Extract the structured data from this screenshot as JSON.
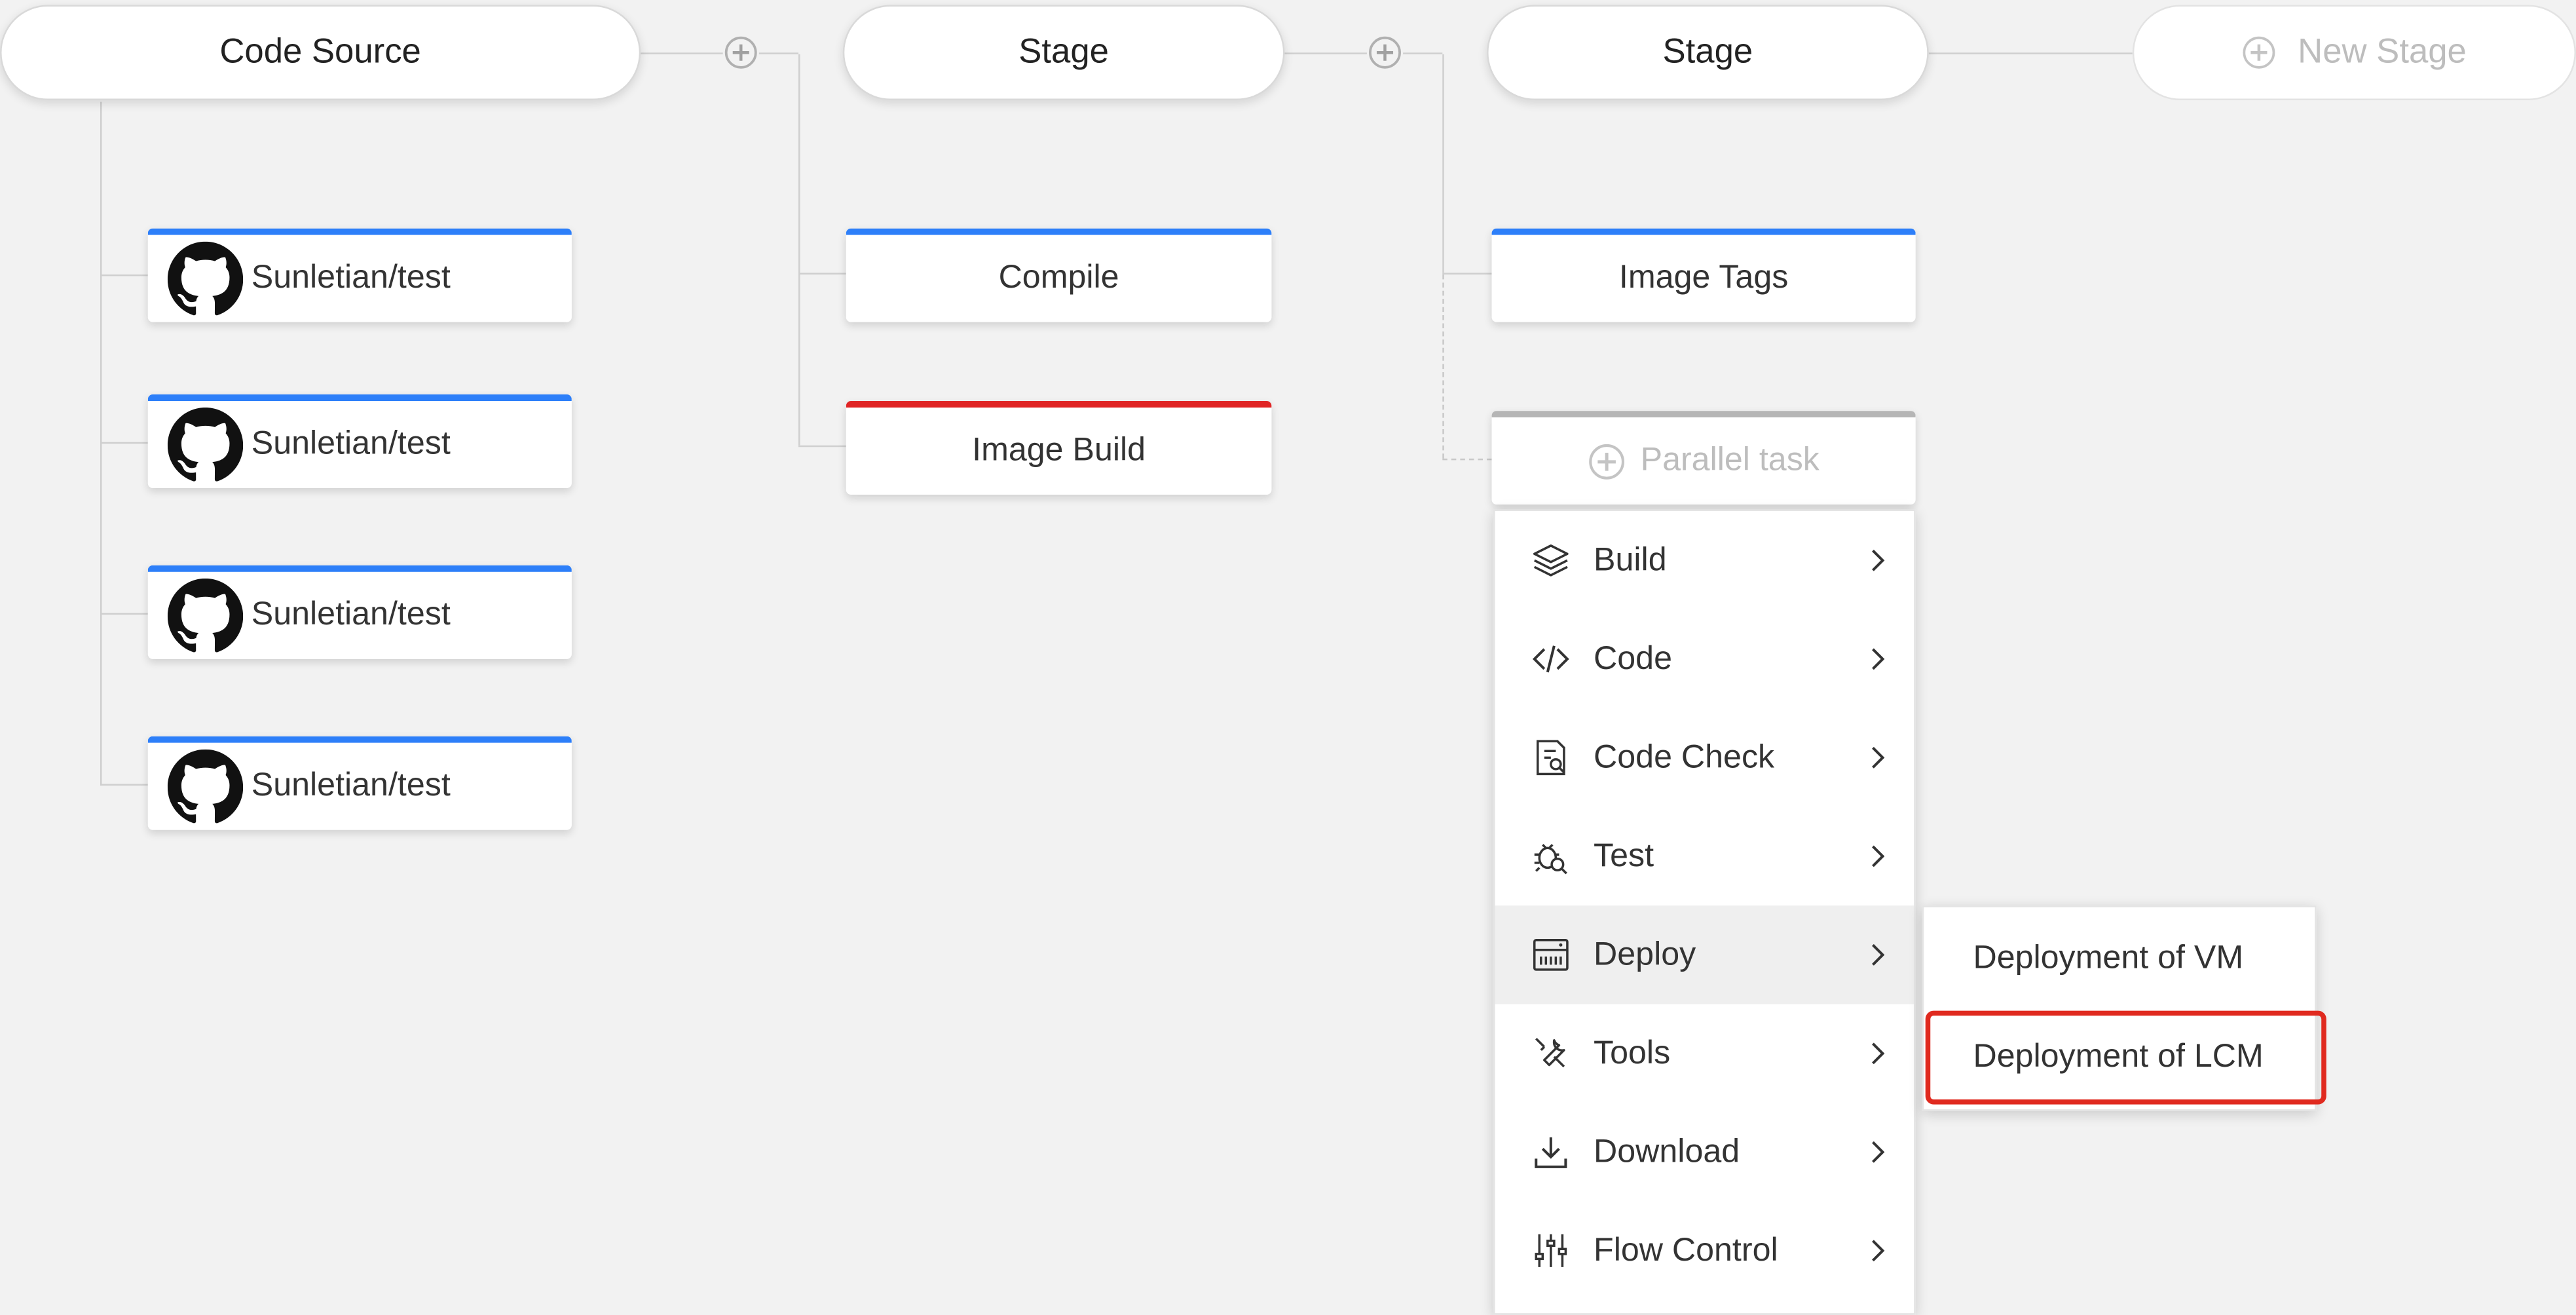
{
  "stages": [
    {
      "label": "Code Source"
    },
    {
      "label": "Stage"
    },
    {
      "label": "Stage"
    },
    {
      "label": "New Stage"
    }
  ],
  "sources": [
    {
      "label": "Sunletian/test"
    },
    {
      "label": "Sunletian/test"
    },
    {
      "label": "Sunletian/test"
    },
    {
      "label": "Sunletian/test"
    }
  ],
  "stage1_tasks": [
    {
      "label": "Compile",
      "status": "blue"
    },
    {
      "label": "Image Build",
      "status": "red"
    }
  ],
  "stage2_tasks": [
    {
      "label": "Image Tags"
    }
  ],
  "parallel_task": {
    "label": "Parallel task"
  },
  "menu": {
    "items": [
      {
        "label": "Build",
        "icon": "layers-icon"
      },
      {
        "label": "Code",
        "icon": "code-icon"
      },
      {
        "label": "Code Check",
        "icon": "code-check-icon"
      },
      {
        "label": "Test",
        "icon": "bug-search-icon"
      },
      {
        "label": "Deploy",
        "icon": "server-icon"
      },
      {
        "label": "Tools",
        "icon": "tools-icon"
      },
      {
        "label": "Download",
        "icon": "download-icon"
      },
      {
        "label": "Flow Control",
        "icon": "sliders-icon"
      }
    ],
    "active": "Deploy"
  },
  "submenu": {
    "items": [
      {
        "label": "Deployment of VM"
      },
      {
        "label": "Deployment of LCM"
      }
    ],
    "highlighted": "Deployment of LCM"
  },
  "colors": {
    "blue_accent": "#2d7ff9",
    "red_accent": "#e02424",
    "highlight": "#e02a1f"
  }
}
